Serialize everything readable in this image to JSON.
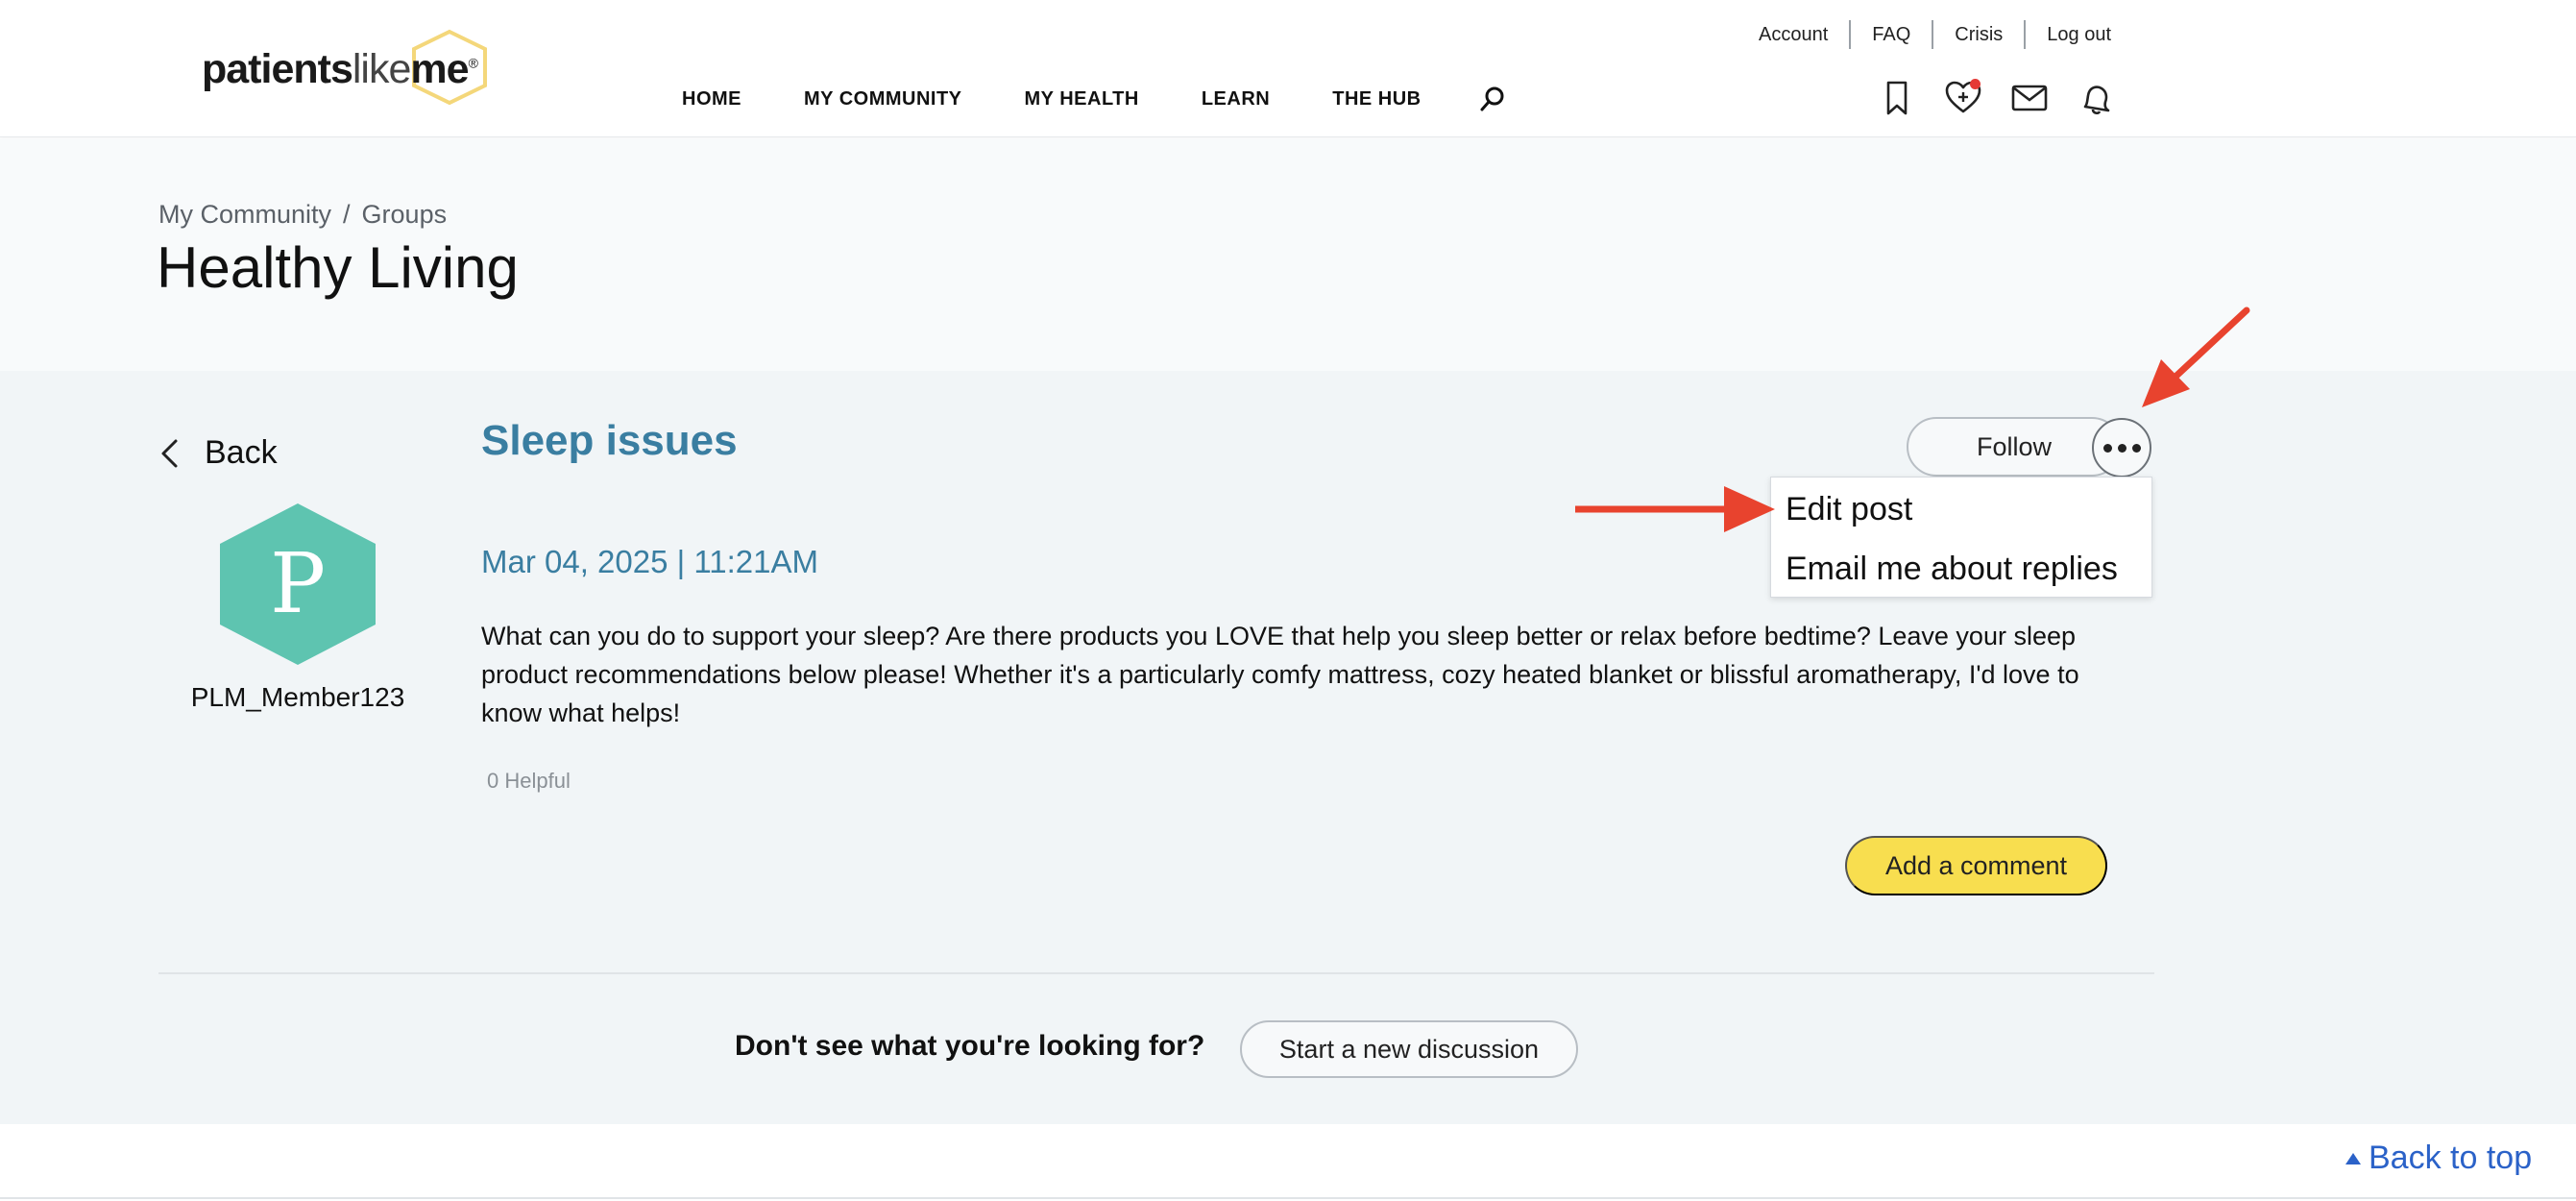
{
  "brand": {
    "logo_part1": "patients",
    "logo_part2": "like",
    "logo_part3": "me",
    "logo_reg": "®",
    "hex_color": "#f4d77a"
  },
  "utility_links": [
    "Account",
    "FAQ",
    "Crisis",
    "Log out"
  ],
  "main_nav": [
    "HOME",
    "MY COMMUNITY",
    "MY HEALTH",
    "LEARN",
    "THE HUB"
  ],
  "header_icons": [
    "search-icon",
    "bookmark-icon",
    "heart-plus-icon",
    "mail-icon",
    "bell-icon"
  ],
  "breadcrumb": [
    "My Community",
    "Groups"
  ],
  "page_title": "Healthy Living",
  "post": {
    "back_label": "Back",
    "avatar_letter": "P",
    "avatar_color": "#5ec4b0",
    "username": "PLM_Member123",
    "title": "Sleep issues",
    "date": "Mar 04, 2025 | 11:21AM",
    "body": "What can you do to support your sleep? Are there products you LOVE that help you sleep better or relax before bedtime? Leave your sleep product recommendations below please! Whether it's a particularly comfy mattress, cozy heated blanket or blissful aromatherapy, I'd love to know what helps!",
    "helpful": "0 Helpful",
    "follow_label": "Follow",
    "add_comment_label": "Add a comment"
  },
  "dropdown": {
    "items": [
      "Edit post",
      "Email me about replies"
    ]
  },
  "footer_cta": {
    "text": "Don't see what you're looking for?",
    "button": "Start a new discussion"
  },
  "back_to_top": "Back to top",
  "colors": {
    "accent_blue": "#3a7ea1",
    "comment_yellow": "#f8de4f",
    "link_blue": "#2b62c8",
    "annotation_red": "#e8432e",
    "notification_red": "#e53935"
  }
}
